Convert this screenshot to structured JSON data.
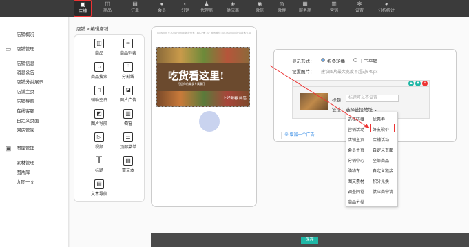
{
  "nav": {
    "items": [
      {
        "label": "店铺",
        "icon": "store-icon",
        "glyph": "▣"
      },
      {
        "label": "商品",
        "icon": "bag-icon",
        "glyph": "◫"
      },
      {
        "label": "订单",
        "icon": "order-icon",
        "glyph": "▤"
      },
      {
        "label": "会员",
        "icon": "member-icon",
        "glyph": "●"
      },
      {
        "label": "分销",
        "icon": "distribution-icon",
        "glyph": "◐"
      },
      {
        "label": "代理商",
        "icon": "agent-icon",
        "glyph": "♟"
      },
      {
        "label": "供应商",
        "icon": "supplier-icon",
        "glyph": "◈"
      },
      {
        "label": "微信",
        "icon": "wechat-icon",
        "glyph": "◉"
      },
      {
        "label": "微博",
        "icon": "weibo-icon",
        "glyph": "◎"
      },
      {
        "label": "服务商",
        "icon": "service-icon",
        "glyph": "▦"
      },
      {
        "label": "营销",
        "icon": "marketing-icon",
        "glyph": "▥"
      },
      {
        "label": "设置",
        "icon": "gear-icon",
        "glyph": "✻"
      },
      {
        "label": "分析统计",
        "icon": "analytics-icon",
        "glyph": "◕"
      }
    ],
    "active_index": 0
  },
  "sidebar": {
    "groups": [
      {
        "icon": "store-group-icon",
        "glyph": "▭"
      },
      {
        "icon": "image-group-icon",
        "glyph": "▣"
      }
    ],
    "items": [
      "店铺概况",
      "店铺管理",
      "店铺信息",
      "消息公告",
      "店铺分类展示",
      "店铺主页",
      "店铺导航",
      "在线客服",
      "自定义页面",
      "网店管家",
      "图库管理",
      "素材管理",
      "图片库",
      "九图一文"
    ]
  },
  "breadcrumb": "店铺 > 编辑店铺",
  "components": [
    {
      "label": "商品",
      "icon": "product-icon",
      "glyph": "◫"
    },
    {
      "label": "商品列表",
      "icon": "product-list-icon",
      "glyph": "∞"
    },
    {
      "label": "商品搜索",
      "icon": "search-icon",
      "glyph": "○"
    },
    {
      "label": "分割线",
      "icon": "divider-icon",
      "glyph": "⫶"
    },
    {
      "label": "辅助空白",
      "icon": "blank-icon",
      "glyph": "▯"
    },
    {
      "label": "图片广告",
      "icon": "image-ad-icon",
      "glyph": "◪"
    },
    {
      "label": "图片导航",
      "icon": "image-nav-icon",
      "glyph": "◩"
    },
    {
      "label": "橱窗",
      "icon": "showcase-icon",
      "glyph": "▥"
    },
    {
      "label": "视频",
      "icon": "video-icon",
      "glyph": "▷"
    },
    {
      "label": "顶部菜单",
      "icon": "top-menu-icon",
      "glyph": "☰"
    },
    {
      "label": "标题",
      "icon": "title-icon",
      "glyph": "T"
    },
    {
      "label": "富文本",
      "icon": "rich-text-icon",
      "glyph": "▤"
    },
    {
      "label": "文本导航",
      "icon": "text-nav-icon",
      "glyph": "▤"
    }
  ],
  "preview": {
    "copyright": "Copyright © 2016 HiShop 版权所有 | 粤ICP备 10 · 联系我们 400-0000000 提供技术支持",
    "banner_title": "吃货看这里!",
    "banner_sub": "打造你的美食专属餐厅",
    "banner_caption": "上好新春 鲜活"
  },
  "settings": {
    "display_label": "显示形式：",
    "option_a": "折叠轮播",
    "option_b": "上下平铺",
    "image_label": "设置图片：",
    "image_hint": "建议图片最大宽度不超过640px",
    "title_label": "标题：",
    "title_placeholder": "标题可以不设置",
    "link_label": "链接：",
    "link_select": "选择链接地址 ⌄",
    "add_label": "增加一个广告"
  },
  "dropdown": {
    "items": [
      [
        "选择链接",
        "优惠券"
      ],
      [
        "营销活动",
        "好友砍价"
      ],
      [
        "店铺主页",
        "店铺活动"
      ],
      [
        "会员主页",
        "自定义页面"
      ],
      [
        "分销中心",
        "全部商品"
      ],
      [
        "购物车",
        "自定义链接"
      ],
      [
        "图文素材",
        "积分兑换"
      ],
      [
        "调查问卷",
        "供应商申请"
      ],
      [
        "商品分类",
        ""
      ]
    ],
    "highlighted": "好友砍价"
  },
  "footer": {
    "save_label": "保存"
  },
  "colors": {
    "accent": "#3a8ee6",
    "save": "#1fb7a6",
    "highlight": "#e33333",
    "nav_bg": "#3b3b3b"
  }
}
